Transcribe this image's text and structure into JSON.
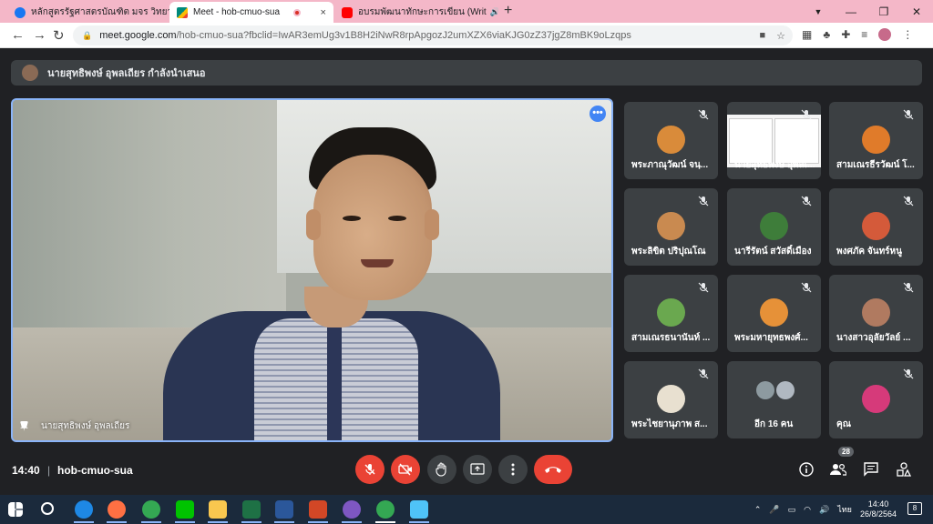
{
  "browser": {
    "tabs": [
      {
        "label": "หลักสูตรรัฐศาสตรบัณฑิต มจร วิทยาเขต",
        "icon": "facebook-icon",
        "color": "#1877f2",
        "close": "×"
      },
      {
        "label": "Meet - hob-cmuo-sua",
        "icon": "google-meet-icon",
        "color": "#00897b",
        "close": "×"
      },
      {
        "label": "อบรมพัฒนาทักษะการเขียน (Writ",
        "icon": "youtube-icon",
        "color": "#ff0000",
        "close": "×"
      }
    ],
    "new_tab": "+",
    "window_controls": {
      "minimize": "—",
      "maximize": "❐",
      "close": "✕"
    },
    "url_host": "meet.google.com",
    "url_path": "/hob-cmuo-sua?fbclid=IwAR3emUg3v1B8H2iNwR8rpApgozJ2umXZX6viaKJG0zZ37jgZ8mBK9oLzqps",
    "nav": {
      "back": "←",
      "forward": "→",
      "reload": "↻"
    }
  },
  "meet": {
    "presenting_banner": "นายสุทธิพงษ์ อุพลเถียร กำลังนำเสนอ",
    "main_speaker": "นายสุทธิพงษ์ อุพลเถียร",
    "participants": [
      {
        "name": "พระภาณุวัฒน์ จนฺ...",
        "avatar_color": "#d98b3a"
      },
      {
        "name": "นายสุทธิพงษ์ อุพลเ...",
        "avatar_color": "#ffffff",
        "screen": true
      },
      {
        "name": "สามเณรธีรวัฒน์ โ...",
        "avatar_color": "#e07b2a"
      },
      {
        "name": "พระลิขิต ปริปุณโณ",
        "avatar_color": "#c98a50"
      },
      {
        "name": "นารีรัตน์ สวัสดิ์เมือง",
        "avatar_color": "#3e7d3a"
      },
      {
        "name": "พงศภัค จันทร์หนู",
        "avatar_color": "#d45a3a"
      },
      {
        "name": "สามเณรธนานันท์ ...",
        "avatar_color": "#6aa84f"
      },
      {
        "name": "พระมหายุทธพงศ์...",
        "avatar_color": "#e69138"
      },
      {
        "name": "นางสาวอุลัยวัลย์ ...",
        "avatar_color": "#b07a60"
      },
      {
        "name": "พระไชยานุภาพ ส...",
        "avatar_color": "#e8e0d0"
      },
      {
        "name": "อีก 16 คน",
        "avatar_color": "#9aa0a6"
      },
      {
        "name": "คุณ",
        "avatar_color": "#d63a7a"
      }
    ],
    "time": "14:40",
    "separator": "|",
    "meeting_code": "hob-cmuo-sua",
    "people_count": "28",
    "accent_red": "#ea4335",
    "accent_blue": "#8ab4f8"
  },
  "taskbar": {
    "apps": [
      "windows-start-icon",
      "search-icon",
      "edge-icon",
      "firefox-icon",
      "chrome-icon",
      "line-icon",
      "file-explorer-icon",
      "excel-icon",
      "word-icon",
      "powerpoint-icon",
      "tor-icon",
      "chrome-active-icon",
      "photos-icon"
    ],
    "language": "ไทย",
    "time": "14:40",
    "date": "26/8/2564",
    "notifications": "8"
  }
}
